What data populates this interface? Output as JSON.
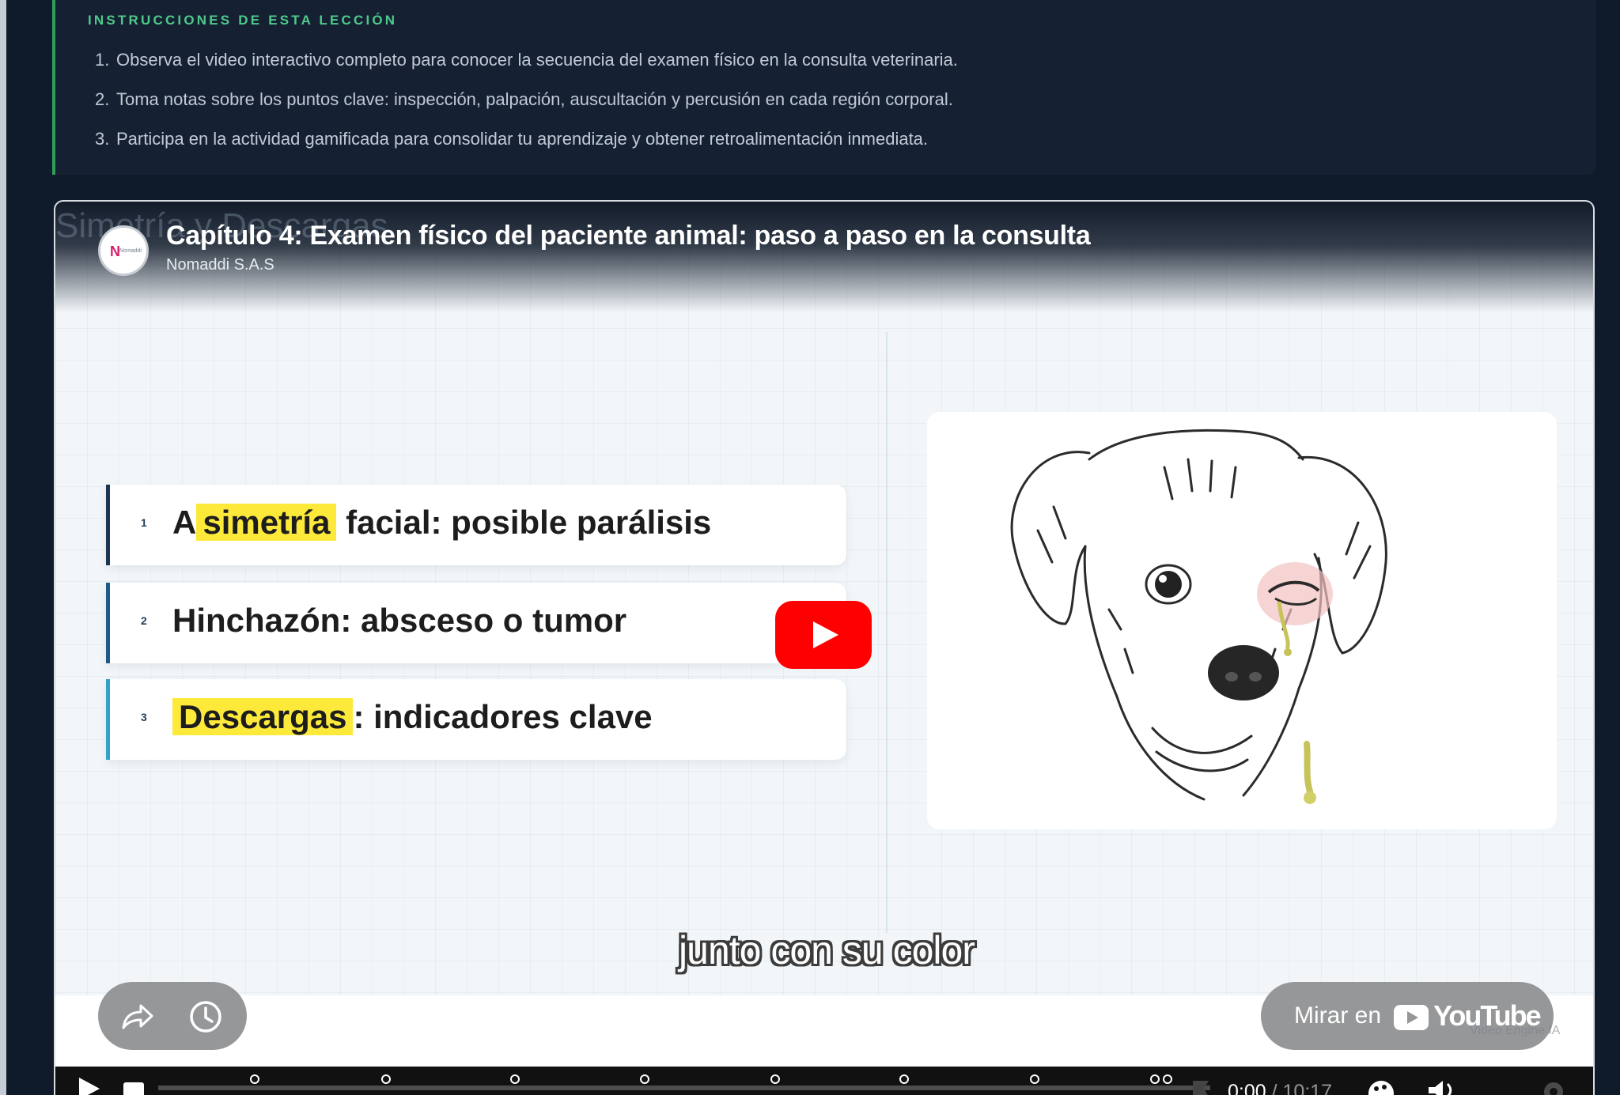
{
  "instructions": {
    "heading": "INSTRUCCIONES DE ESTA LECCIÓN",
    "items": [
      {
        "num": "1.",
        "text": "Observa el video interactivo completo para conocer la secuencia del examen físico en la consulta veterinaria."
      },
      {
        "num": "2.",
        "text": "Toma notas sobre los puntos clave: inspección, palpación, auscultación y percusión en cada región corporal."
      },
      {
        "num": "3.",
        "text": "Participa en la actividad gamificada para consolidar tu aprendizaje y obtener retroalimentación inmediata."
      }
    ]
  },
  "video": {
    "ghost_title": "Simetría y Descargas",
    "title": "Capítulo 4: Examen físico del paciente animal: paso a paso en la consulta",
    "channel": "Nomaddi S.A.S",
    "channel_logo_text": "Nomaddi",
    "slide": {
      "items": [
        {
          "num": "1",
          "pre": "A",
          "highlight": "simetría",
          "post": " facial: posible parálisis",
          "bar_color": "#1b3552"
        },
        {
          "num": "2",
          "pre": "",
          "highlight": "",
          "post": "Hinchazón: absceso o tumor",
          "bar_color": "#1e5a86"
        },
        {
          "num": "3",
          "pre": "",
          "highlight": "Descargas",
          "post": ": indicadores clave",
          "bar_color": "#2fa3c8"
        }
      ]
    },
    "caption": "junto con su color",
    "watch_on_label": "Mirar en",
    "youtube_word": "YouTube",
    "engine_mark": "Video Engine IA",
    "time_current": "0:00",
    "time_separator": " / ",
    "time_duration": "10:17",
    "progress": 0,
    "chapter_marker_count": 8
  },
  "icons": {
    "share": "share-icon",
    "clock": "watch-later-icon",
    "settings": "gear-icon",
    "volume": "volume-icon",
    "fullscreen": "fullscreen-icon"
  }
}
